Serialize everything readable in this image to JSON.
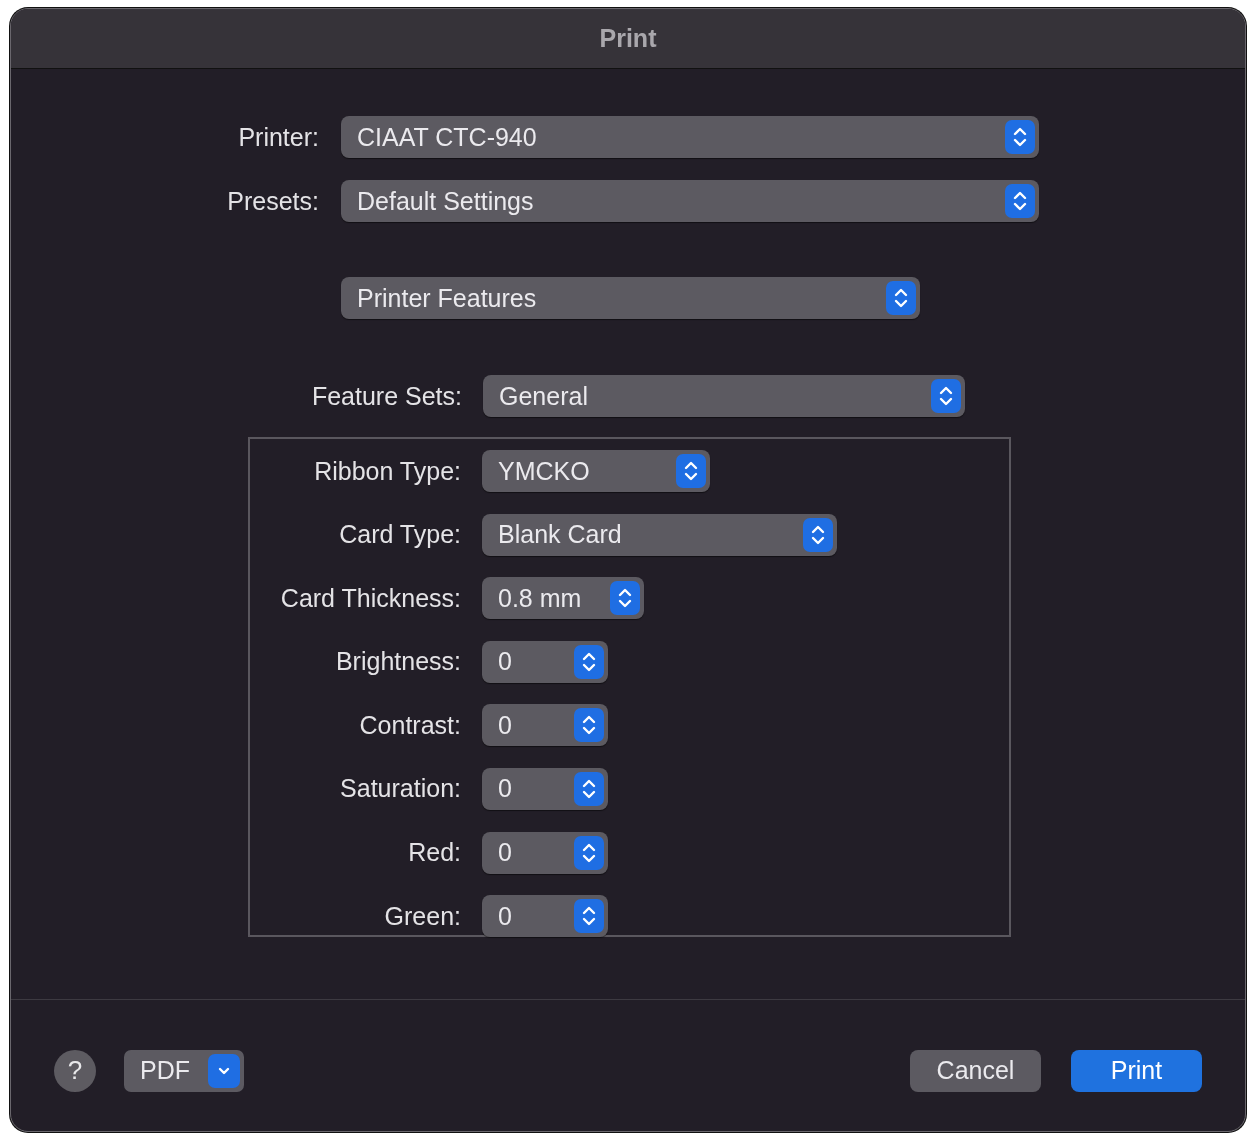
{
  "window": {
    "title": "Print"
  },
  "top_fields": [
    {
      "label": "Printer:",
      "value": "CIAAT CTC-940"
    },
    {
      "label": "Presets:",
      "value": "Default Settings"
    }
  ],
  "panel_menu": {
    "value": "Printer Features"
  },
  "feature_sets": {
    "label": "Feature Sets:",
    "value": "General"
  },
  "features": [
    {
      "label": "Ribbon Type:",
      "value": "YMCKO"
    },
    {
      "label": "Card Type:",
      "value": "Blank Card"
    },
    {
      "label": "Card Thickness:",
      "value": "0.8 mm"
    },
    {
      "label": "Brightness:",
      "value": "0"
    },
    {
      "label": "Contrast:",
      "value": "0"
    },
    {
      "label": "Saturation:",
      "value": "0"
    },
    {
      "label": "Red:",
      "value": "0"
    },
    {
      "label": "Green:",
      "value": "0"
    }
  ],
  "footer": {
    "help": "?",
    "pdf": "PDF",
    "buttons": [
      {
        "label": "Cancel",
        "kind": "normal"
      },
      {
        "label": "Print",
        "kind": "default"
      }
    ]
  }
}
